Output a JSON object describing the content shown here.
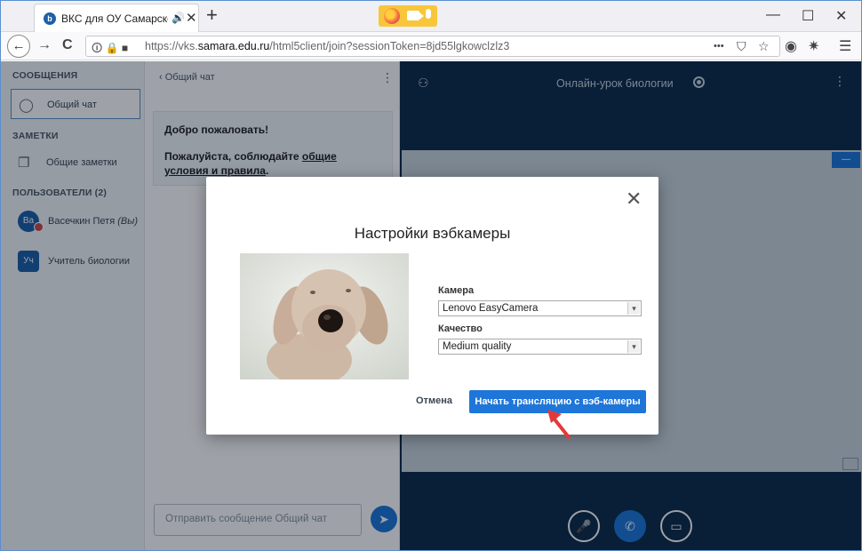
{
  "browser": {
    "tab_title": "ВКС для ОУ Самарской об",
    "tab_favicon": "b",
    "tab_audio_icon": "🔊",
    "tab_close": "✕",
    "new_tab": "+",
    "win_min": "—",
    "win_max": "☐",
    "win_close": "✕",
    "url_prefix": "https://vks.",
    "url_domain": "samara.edu.ru",
    "url_path": "/html5client/join?sessionToken=8jd55lgkowclzlz3",
    "url_icons": "🛈 🔒 ■",
    "back": "←",
    "forward": "→",
    "reload": "C",
    "more_icon": "•••",
    "pocket_icon": "⛉",
    "star_icon": "☆",
    "account_icon": "◉",
    "extensions_icon": "✷",
    "menu_icon": "☰"
  },
  "sidebar": {
    "messages_header": "СООБЩЕНИЯ",
    "public_chat_label": "Общий чат",
    "notes_header": "ЗАМЕТКИ",
    "shared_notes_label": "Общие заметки",
    "users_header": "ПОЛЬЗОВАТЕЛИ (2)",
    "users": [
      {
        "initials": "Ва",
        "name": "Васечкин Петя",
        "suffix": "(Вы)"
      },
      {
        "initials": "Уч",
        "name": "Учитель биологии"
      }
    ]
  },
  "chat": {
    "back_label": "‹  Общий чат",
    "kebab": "⋮",
    "welcome_line1": "Добро пожаловать!",
    "welcome_line2": "Пожалуйста, соблюдайте ",
    "welcome_link": "общие условия и правила",
    "welcome_end": ".",
    "input_placeholder": "Отправить сообщение Общий чат",
    "send_icon": "➤"
  },
  "presentation": {
    "title": "Онлайн-урок биологии",
    "user_icon": "⚇",
    "kebab": "⋮",
    "minimize_label": "—",
    "mic_icon": "🎤",
    "phone_icon": "✆",
    "cam_icon": "▭"
  },
  "modal": {
    "title": "Настройки вэбкамеры",
    "close": "✕",
    "camera_label": "Камера",
    "camera_value": "Lenovo EasyCamera",
    "quality_label": "Качество",
    "quality_value": "Medium quality",
    "select_arrow": "▾",
    "cancel_label": "Отмена",
    "start_label": "Начать трансляцию с вэб-камеры"
  },
  "colors": {
    "accent_blue": "#1e76d9",
    "presentation_bg": "#0f2a4a",
    "pointer_red": "#e23a3a"
  }
}
